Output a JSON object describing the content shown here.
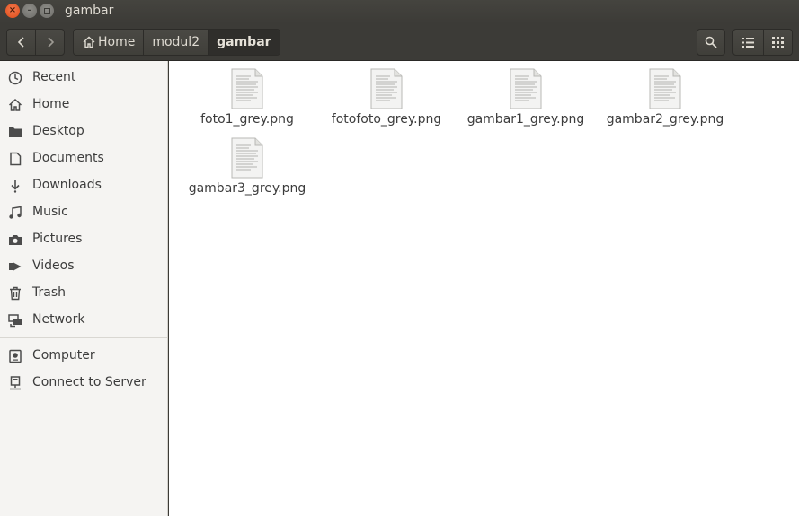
{
  "window": {
    "title": "gambar"
  },
  "toolbar": {
    "breadcrumbs": [
      "Home",
      "modul2",
      "gambar"
    ]
  },
  "sidebar": {
    "items": [
      {
        "label": "Recent",
        "icon": "clock-icon"
      },
      {
        "label": "Home",
        "icon": "home-icon"
      },
      {
        "label": "Desktop",
        "icon": "folder-icon"
      },
      {
        "label": "Documents",
        "icon": "document-icon"
      },
      {
        "label": "Downloads",
        "icon": "download-icon"
      },
      {
        "label": "Music",
        "icon": "music-icon"
      },
      {
        "label": "Pictures",
        "icon": "camera-icon"
      },
      {
        "label": "Videos",
        "icon": "video-icon"
      },
      {
        "label": "Trash",
        "icon": "trash-icon"
      },
      {
        "label": "Network",
        "icon": "network-icon"
      }
    ],
    "devices": [
      {
        "label": "Computer",
        "icon": "computer-icon"
      },
      {
        "label": "Connect to Server",
        "icon": "server-icon"
      }
    ]
  },
  "files": [
    {
      "name": "foto1_grey.png"
    },
    {
      "name": "fotofoto_grey.png"
    },
    {
      "name": "gambar1_grey.png"
    },
    {
      "name": "gambar2_grey.png"
    },
    {
      "name": "gambar3_grey.png"
    }
  ],
  "colors": {
    "titlebar": "#3c3b37",
    "close_button": "#df4a16",
    "sidebar_bg": "#f5f4f2",
    "content_bg": "#ffffff"
  }
}
